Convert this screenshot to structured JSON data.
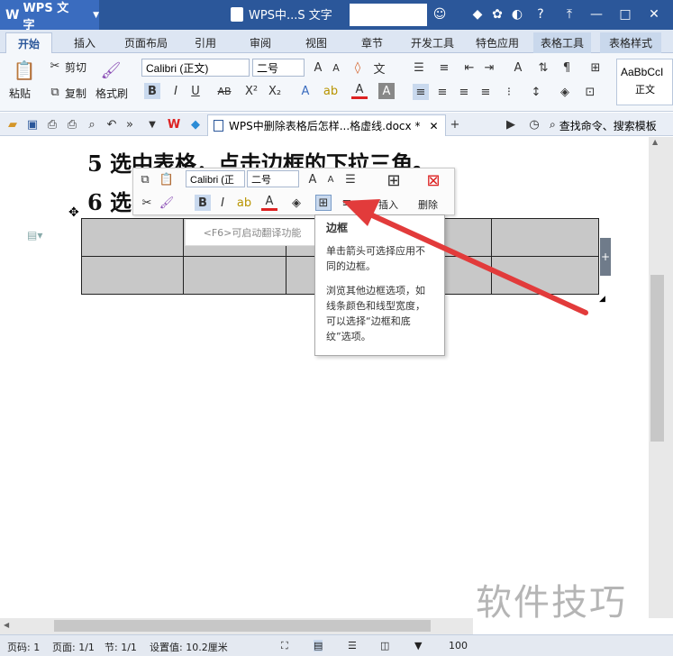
{
  "title_bar": {
    "app_name": "WPS 文字",
    "doc_title": "WPS中...S 文字"
  },
  "tabs": [
    "开始",
    "插入",
    "页面布局",
    "引用",
    "审阅",
    "视图",
    "章节",
    "开发工具",
    "特色应用",
    "表格工具",
    "表格样式"
  ],
  "ribbon": {
    "paste": "粘贴",
    "cut": "剪切",
    "copy": "复制",
    "format_painter": "格式刷",
    "font_name": "Calibri (正文)",
    "font_size": "二号",
    "style_preview": "AaBbCcI",
    "style_name": "正文"
  },
  "quick_access": {
    "doc_tab": "WPS中删除表格后怎样...格虚线.docx *",
    "search": "查找命令、搜索模板"
  },
  "document": {
    "line5": "5 选中表格，点击边框的下拉三角。",
    "line6": "6 选"
  },
  "mini_toolbar": {
    "font_name": "Calibri (正",
    "font_size": "二号",
    "insert": "插入",
    "delete": "删除"
  },
  "translate_hint": "<F6>可启动翻译功能",
  "tooltip": {
    "title": "边框",
    "desc1": "单击箭头可选择应用不同的边框。",
    "desc2": "浏览其他边框选项，如线条颜色和线型宽度，可以选择“边框和底纹”选项。"
  },
  "status_bar": {
    "page_no": "页码: 1",
    "pages": "页面: 1/1",
    "section": "节: 1/1",
    "setting": "设置值: 10.2厘米",
    "zoom": "100"
  },
  "watermark": "软件技巧",
  "colors": {
    "title_bar": "#2b579a",
    "table_fill": "#c8c8c8",
    "arrow": "#e23b3b"
  }
}
